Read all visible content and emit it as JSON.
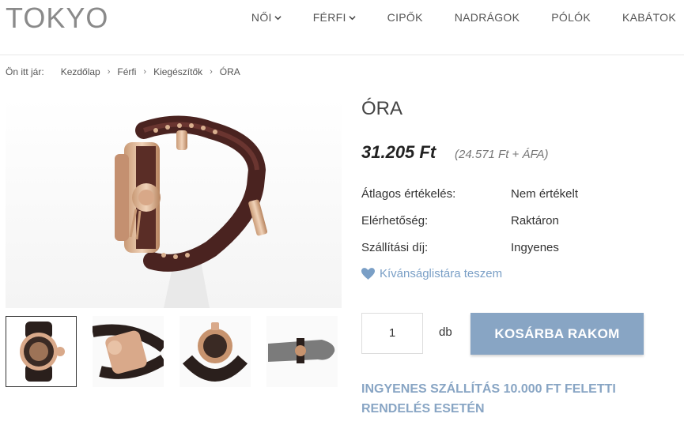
{
  "header": {
    "logo": "TOKYO",
    "nav": [
      {
        "label": "NŐI",
        "dropdown": true
      },
      {
        "label": "FÉRFI",
        "dropdown": true
      },
      {
        "label": "CIPŐK",
        "dropdown": false
      },
      {
        "label": "NADRÁGOK",
        "dropdown": false
      },
      {
        "label": "PÓLÓK",
        "dropdown": false
      },
      {
        "label": "KABÁTOK",
        "dropdown": false
      }
    ]
  },
  "breadcrumb": {
    "prefix": "Ön itt jár:",
    "items": [
      "Kezdőlap",
      "Férfi",
      "Kiegészítők",
      "ÓRA"
    ],
    "separator": "›"
  },
  "product": {
    "title": "ÓRA",
    "price": "31.205 Ft",
    "net_price": "(24.571 Ft + ÁFA)",
    "specs": [
      {
        "label": "Átlagos értékelés:",
        "value": "Nem értékelt"
      },
      {
        "label": "Elérhetőség:",
        "value": "Raktáron"
      },
      {
        "label": "Szállítási díj:",
        "value": "Ingyenes"
      }
    ],
    "wishlist_label": "Kívánságlistára teszem",
    "quantity": "1",
    "unit": "db",
    "cart_button": "KOSÁRBA RAKOM",
    "free_shipping": "INGYENES SZÁLLÍTÁS 10.000 FT FELETTI RENDELÉS ESETÉN"
  },
  "colors": {
    "accent": "#88a5c4",
    "link": "#7a9fc6",
    "text": "#333333"
  }
}
